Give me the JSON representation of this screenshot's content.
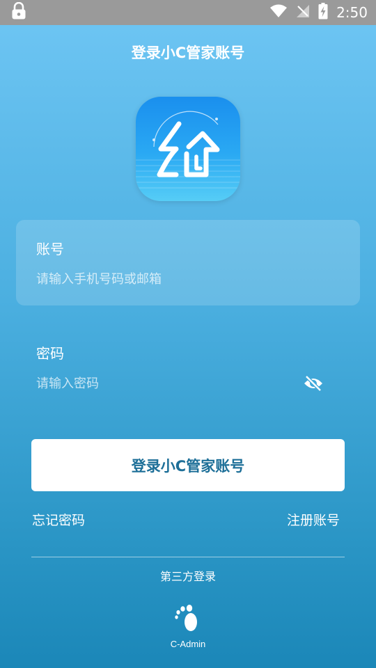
{
  "status_bar": {
    "time": "2:50",
    "icons": [
      "lock-icon",
      "wifi-icon",
      "no-signal-icon",
      "battery-charging-icon"
    ]
  },
  "page": {
    "title": "登录小C管家账号"
  },
  "logo": {
    "icon": "home-logo-icon"
  },
  "account": {
    "label": "账号",
    "placeholder": "请输入手机号码或邮箱",
    "value": ""
  },
  "password": {
    "label": "密码",
    "placeholder": "请输入密码",
    "value": "",
    "toggle_icon": "eye-off-icon"
  },
  "login_button": {
    "label": "登录小C管家账号"
  },
  "links": {
    "forgot": "忘记密码",
    "register": "注册账号"
  },
  "third_party": {
    "label": "第三方登录",
    "providers": [
      {
        "name": "C-Admin",
        "icon": "footprint-icon"
      }
    ]
  },
  "colors": {
    "gradient_top": "#6fc6f4",
    "gradient_bottom": "#1b87b8",
    "button_text": "#1d6f98",
    "status_bar": "#9a9a9a"
  }
}
